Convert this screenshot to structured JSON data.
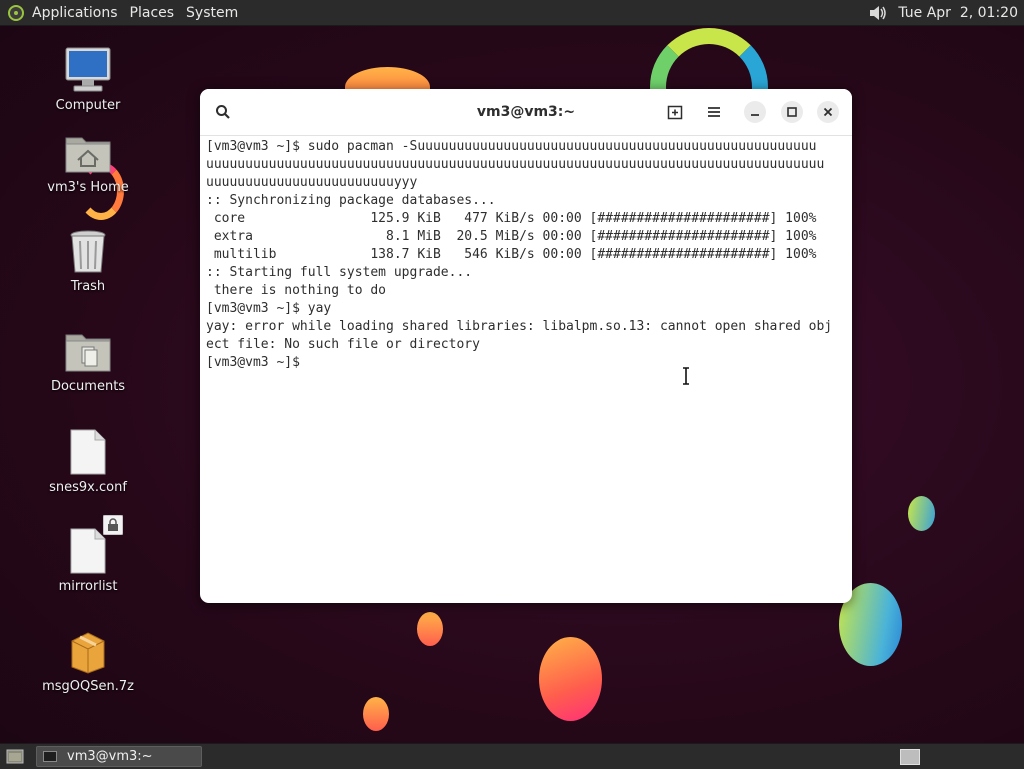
{
  "top_panel": {
    "menus": [
      "Applications",
      "Places",
      "System"
    ],
    "clock": "Tue Apr  2, 01:20",
    "logo_icon": "mate-logo-icon",
    "volume_icon": "speaker-volume-icon"
  },
  "desktop": {
    "icons": [
      {
        "label": "Computer",
        "icon": "computer-icon"
      },
      {
        "label": "vm3's Home",
        "icon": "home-folder-icon"
      },
      {
        "label": "Trash",
        "icon": "trash-icon"
      },
      {
        "label": "Documents",
        "icon": "documents-folder-icon"
      },
      {
        "label": "snes9x.conf",
        "icon": "text-file-icon"
      },
      {
        "label": "mirrorlist",
        "icon": "locked-file-icon"
      },
      {
        "label": "msgOQSen.7z",
        "icon": "archive-icon"
      }
    ]
  },
  "terminal": {
    "title": "vm3@vm3:~",
    "buttons": [
      "search-icon",
      "new-tab-icon",
      "menu-icon",
      "minimize-icon",
      "maximize-icon",
      "close-icon"
    ],
    "lines": [
      "[vm3@vm3 ~]$ sudo pacman -Suuuuuuuuuuuuuuuuuuuuuuuuuuuuuuuuuuuuuuuuuuuuuuuuuuu",
      "uuuuuuuuuuuuuuuuuuuuuuuuuuuuuuuuuuuuuuuuuuuuuuuuuuuuuuuuuuuuuuuuuuuuuuuuuuuuuuu",
      "uuuuuuuuuuuuuuuuuuuuuuuuyyy",
      ":: Synchronizing package databases...",
      " core                125.9 KiB   477 KiB/s 00:00 [######################] 100%",
      " extra                 8.1 MiB  20.5 MiB/s 00:00 [######################] 100%",
      " multilib            138.7 KiB   546 KiB/s 00:00 [######################] 100%",
      ":: Starting full system upgrade...",
      " there is nothing to do",
      "[vm3@vm3 ~]$ yay",
      "yay: error while loading shared libraries: libalpm.so.13: cannot open shared obj",
      "ect file: No such file or directory",
      "[vm3@vm3 ~]$ "
    ]
  },
  "bottom_panel": {
    "task_label": "vm3@vm3:~",
    "show_desktop_icon": "show-desktop-icon",
    "workspace_icon": "workspace-switcher-icon"
  },
  "colors": {
    "panel": "#2b2b2b",
    "wallpaper": "#260819",
    "terminal_bg": "#ffffff",
    "terminal_text": "#2e2e2e"
  }
}
